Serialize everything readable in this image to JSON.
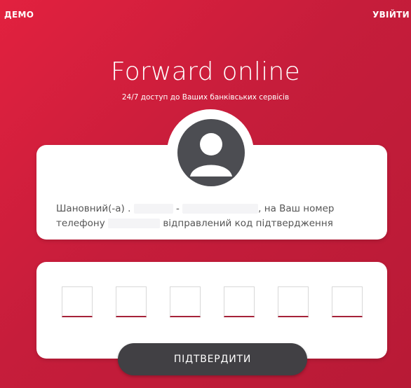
{
  "header": {
    "demo_label": "ДЕМО",
    "login_label": "УВІЙТИ"
  },
  "hero": {
    "title": "Forward online",
    "subtitle": "24/7 доступ до Ваших банківських сервісів"
  },
  "avatar": {
    "icon": "user-avatar-icon"
  },
  "message": {
    "greeting_prefix": "Шановний(-а) .",
    "name_sep": "-",
    "after_name": ", на Ваш номер",
    "phone_prefix": "телефону",
    "after_phone": "відправлений код підтвердження"
  },
  "code_inputs": {
    "count": 6
  },
  "actions": {
    "confirm_label": "ПІДТВЕРДИТИ"
  },
  "colors": {
    "brand": "#d11f3d",
    "button": "#414044",
    "avatar": "#4c4d52"
  }
}
